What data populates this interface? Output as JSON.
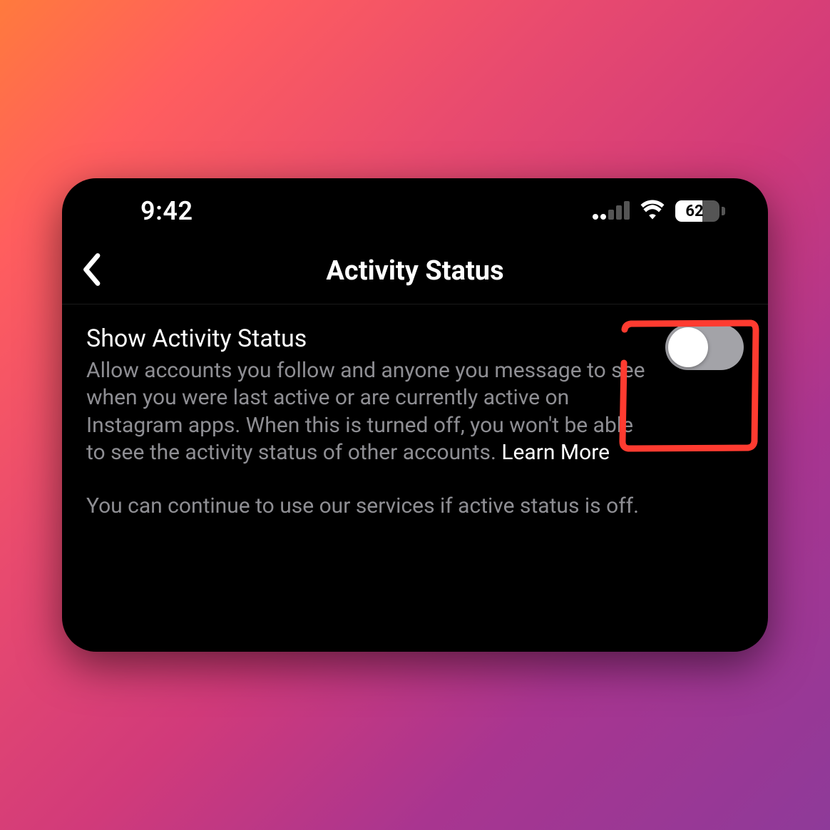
{
  "status_bar": {
    "time": "9:42",
    "battery_percent": "62"
  },
  "nav": {
    "title": "Activity Status"
  },
  "setting": {
    "title": "Show Activity Status",
    "description": "Allow accounts you follow and anyone you message to see when you were last active or are currently active on Instagram apps. When this is turned off, you won't be able to see the activity status of other accounts. ",
    "learn_more": "Learn More",
    "extra": "You can continue to use our services if active status is off.",
    "toggle_on": false
  },
  "annotation": {
    "color": "#ff3b30"
  }
}
